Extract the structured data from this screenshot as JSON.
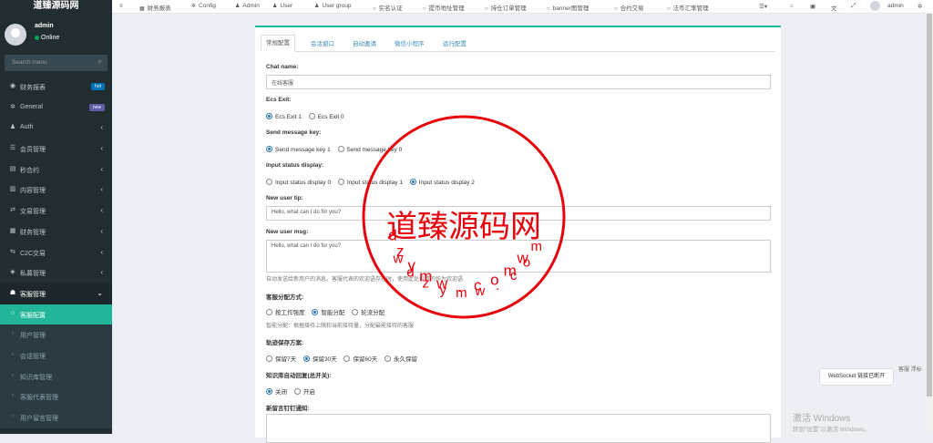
{
  "app": {
    "logo": "道臻源码网"
  },
  "user": {
    "name": "admin",
    "status": "Online"
  },
  "search": {
    "placeholder": "Search menu"
  },
  "menu": [
    {
      "icon": "dashboard-icon",
      "label": "财务报表",
      "badge": "hot",
      "badge_color": "#0073b7"
    },
    {
      "icon": "gears-icon",
      "label": "General",
      "badge": "new",
      "badge_color": "#605ca8"
    },
    {
      "icon": "group-icon",
      "label": "Auth",
      "arrow": "‹"
    },
    {
      "icon": "list-icon",
      "label": "会员管理",
      "arrow": "‹"
    },
    {
      "icon": "calendar-icon",
      "label": "秒合约",
      "arrow": "‹"
    },
    {
      "icon": "folder-icon",
      "label": "内容管理",
      "arrow": "‹"
    },
    {
      "icon": "exchange-icon",
      "label": "交易管理",
      "arrow": "‹"
    },
    {
      "icon": "money-icon",
      "label": "财务管理",
      "arrow": "‹"
    },
    {
      "icon": "c2c-icon",
      "label": "C2C交易",
      "arrow": "‹"
    },
    {
      "icon": "diamond-icon",
      "label": "私募管理",
      "arrow": "‹"
    },
    {
      "icon": "support-icon",
      "label": "客服管理",
      "arrow": "⌄"
    },
    {
      "icon": "circle-icon",
      "label": "客服配置"
    },
    {
      "icon": "circle-icon",
      "label": "用户管理"
    },
    {
      "icon": "circle-icon",
      "label": "会话管理"
    },
    {
      "icon": "circle-icon",
      "label": "知识库管理"
    },
    {
      "icon": "circle-icon",
      "label": "客服代表管理"
    },
    {
      "icon": "circle-icon",
      "label": "用户留言管理"
    }
  ],
  "topnav": {
    "items": [
      {
        "icon": "≡",
        "label": ""
      },
      {
        "icon": "▦",
        "label": "财务报表"
      },
      {
        "icon": "✲",
        "label": "Config"
      },
      {
        "icon": "♟",
        "label": "Admin"
      },
      {
        "icon": "♟",
        "label": "User"
      },
      {
        "icon": "♟",
        "label": "User group"
      },
      {
        "icon": "○",
        "label": "实名认证"
      },
      {
        "icon": "○",
        "label": "提币地址管理"
      },
      {
        "icon": "○",
        "label": "持仓订单管理"
      },
      {
        "icon": "○",
        "label": "banner图管理"
      },
      {
        "icon": "○",
        "label": "合约交易"
      },
      {
        "icon": "○",
        "label": "法币汇率管理"
      }
    ],
    "right": {
      "admin": "admin"
    }
  },
  "tabs": [
    "常规配置",
    "会话窗口",
    "自动邀请",
    "微信小程序",
    "运行配置"
  ],
  "form": {
    "chat_name": {
      "label": "Chat name:",
      "value": "在线客服"
    },
    "ecs_exit": {
      "label": "Ecs Exit:",
      "options": [
        "Ecs Exit 1",
        "Ecs Exit 0"
      ]
    },
    "send_key": {
      "label": "Send message key:",
      "options": [
        "Send message key 1",
        "Send message key 0"
      ]
    },
    "input_status": {
      "label": "Input status display:",
      "options": [
        "Input status display 0",
        "Input status display 1",
        "Input status display 2"
      ]
    },
    "new_user_tip": {
      "label": "New user tip:",
      "value": "Hello, what can I do for you?"
    },
    "new_user_msg": {
      "label": "New user msg:",
      "value": "Hello, what can I do for you?"
    },
    "new_user_help": "自动发送给新用户的消息。客服代表的欢迎语存在时，使用此处设置的作为欢迎语",
    "dispatch": {
      "label": "客服分配方式:",
      "options": [
        "按工作强度",
        "智能分配",
        "轮流分配"
      ],
      "help": "智能分配：根据接待上限和当前接待量，分配最能接待的客服"
    },
    "keep": {
      "label": "轨迹保存方案:",
      "options": [
        "保留7天",
        "保留30天",
        "保留60天",
        "永久保留"
      ]
    },
    "auto_reply": {
      "label": "知识库自动回复(总开关):",
      "options": [
        "关闭",
        "开启"
      ]
    },
    "dingtalk": {
      "label": "新留言钉钉通知:"
    }
  },
  "websocket_tip": "WebSocket 链接已断开",
  "kefu_img_alt": "客服 浮标",
  "windows": {
    "title": "激活 Windows",
    "sub": "转到\"设置\"以激活 Windows。"
  },
  "watermark": {
    "center": "道臻源码网",
    "ring": "dzymw.com"
  }
}
